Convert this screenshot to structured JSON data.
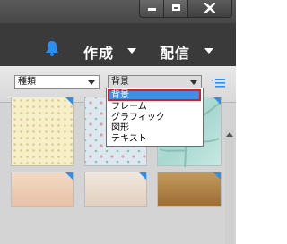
{
  "window": {
    "minimize_icon": "minimize-icon",
    "maximize_icon": "maximize-icon",
    "close_icon": "close-icon"
  },
  "header": {
    "notifications_icon": "bell-icon",
    "create_label": "作成",
    "share_label": "配信",
    "accent_color": "#2a8ff0"
  },
  "toolbar": {
    "type_select_value": "種類",
    "category_select_value": "背景",
    "view_options_icon": "list-view-icon"
  },
  "dropdown": {
    "items": [
      "背景",
      "フレーム",
      "グラフィック",
      "図形",
      "テキスト"
    ],
    "selected_index": 0,
    "highlight_color": "#3c8ee6",
    "selected_border_color": "#d61f26"
  },
  "thumbnails": {
    "badge_color": "#2a8ff0"
  }
}
